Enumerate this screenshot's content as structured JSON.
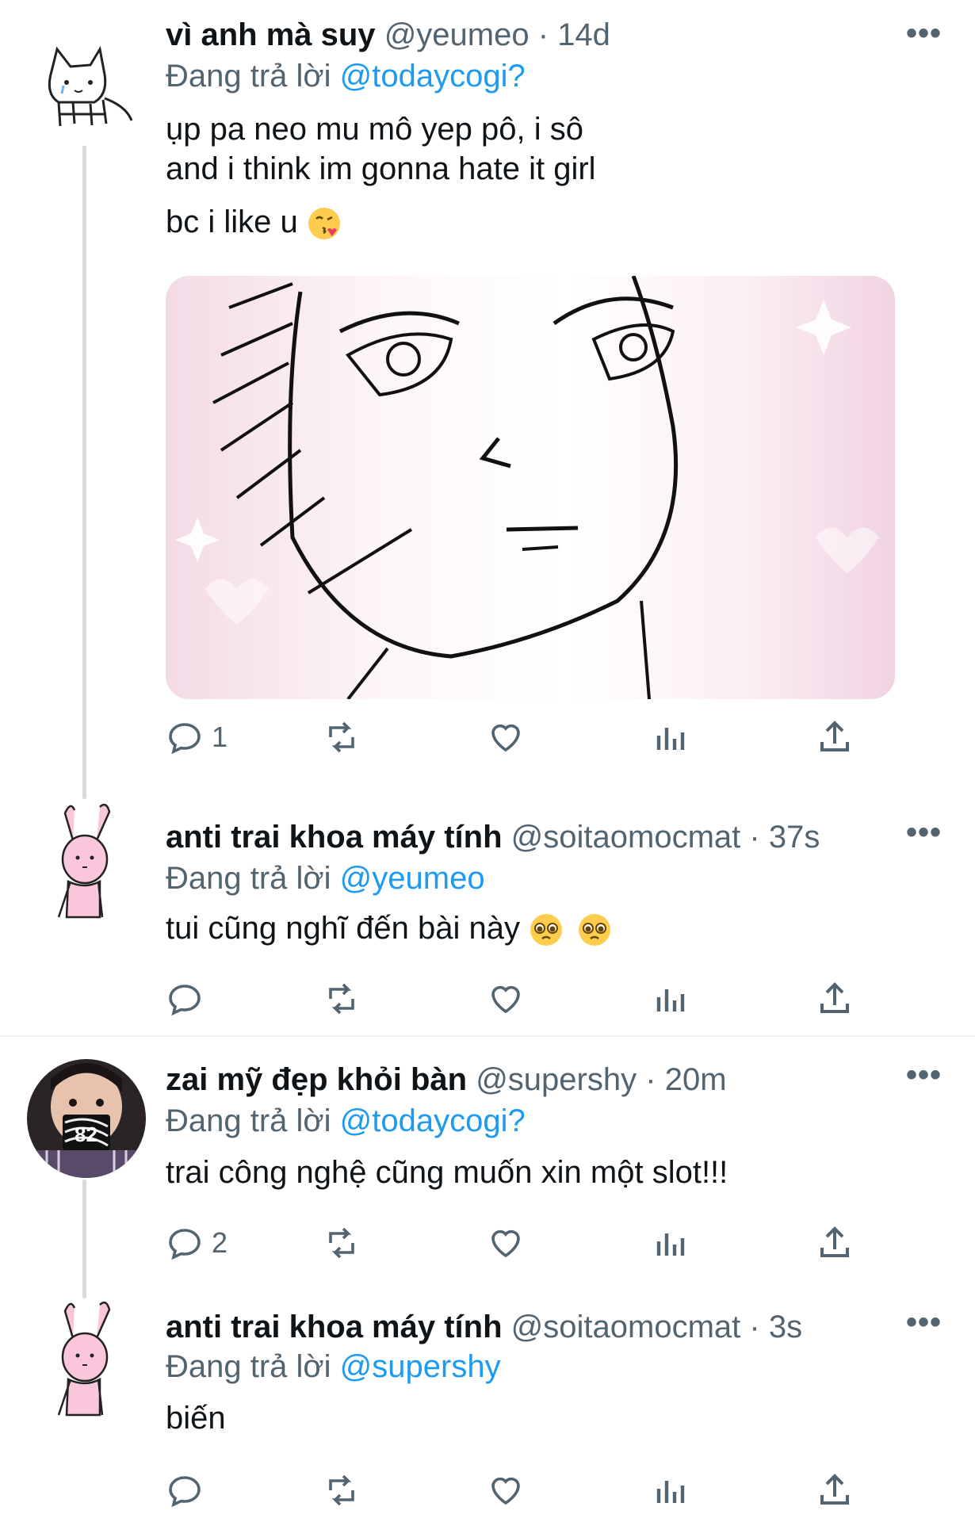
{
  "tweets": [
    {
      "name": "vì anh mà suy",
      "handle": "@yeumeo",
      "time": "14d",
      "replying_prefix": "Đang trả lời",
      "replying_to": "@todaycogi?",
      "lines": [
        "ụp pa neo mu mô yep pô, i sô",
        "and i think im gonna hate it girl",
        "bc i like u"
      ],
      "emoji": "kissing-face-with-heart-emoji",
      "reply_count": "1",
      "avatar_icon": "cat-doodle-avatar"
    },
    {
      "name": "anti trai khoa máy tính",
      "handle": "@soitaomocmat",
      "time": "37s",
      "replying_prefix": "Đang trả lời",
      "replying_to": "@yeumeo",
      "lines": [
        "tui cũng nghĩ đến bài này"
      ],
      "emoji": "pleading-face-emoji",
      "reply_count": "",
      "avatar_icon": "pink-bunny-avatar"
    },
    {
      "name": "zai mỹ đẹp khỏi bàn",
      "handle": "@supershy",
      "time": "20m",
      "replying_prefix": "Đang trả lời",
      "replying_to": "@todaycogi?",
      "lines": [
        "trai công nghệ cũng muốn xin một slot!!!"
      ],
      "reply_count": "2",
      "avatar_icon": "photo-avatar"
    },
    {
      "name": "anti trai khoa máy tính",
      "handle": "@soitaomocmat",
      "time": "3s",
      "replying_prefix": "Đang trả lời",
      "replying_to": "@supershy",
      "lines": [
        "biến"
      ],
      "reply_count": "",
      "avatar_icon": "pink-bunny-avatar"
    }
  ],
  "separator": "·",
  "more_glyph": "•••",
  "colors": {
    "link": "#1d9bf0",
    "muted": "#536471",
    "text": "#0f1419",
    "thread": "#d6dbdf"
  }
}
